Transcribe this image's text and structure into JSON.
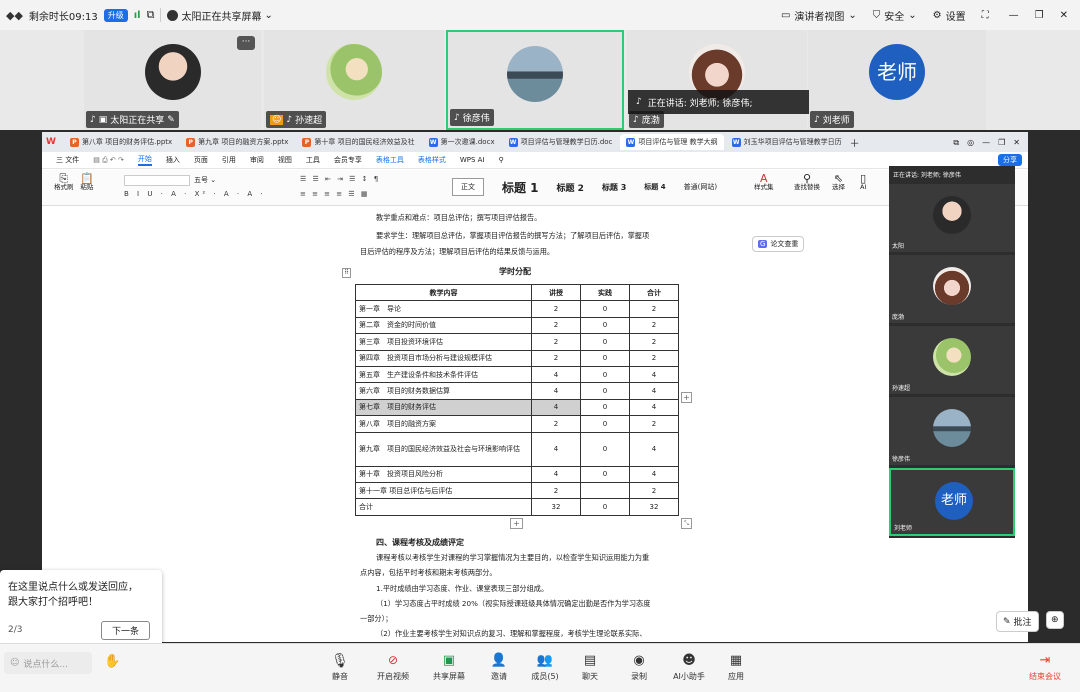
{
  "topbar": {
    "time_left": "剩余时长09:13",
    "upgrade": "升级",
    "sharing": "太阳正在共享屏幕",
    "presenter_view": "演讲者视图",
    "security": "安全",
    "settings": "设置"
  },
  "participants": [
    {
      "name": "太阳正在共享",
      "avatar_color": "#3a3a3a"
    },
    {
      "name": "孙速超",
      "avatar_color": "#7aa24a"
    },
    {
      "name": "徐彦伟",
      "avatar_color": "#6d8aa0"
    },
    {
      "name": "庞渤",
      "avatar_color": "#8a5a4a"
    },
    {
      "name": "刘老师",
      "avatar_text": "老师",
      "avatar_color": "#1f5fbf"
    }
  ],
  "speaking": "正在讲话:  刘老师; 徐彦伟;",
  "doc_tabs": [
    {
      "label": "第八章 项目的财务评估.pptx",
      "type": "P"
    },
    {
      "label": "第九章 项目的融资方案.pptx",
      "type": "P"
    },
    {
      "label": "第十章 项目的国民经济效益及社",
      "type": "P"
    },
    {
      "label": "第一次邀课.docx",
      "type": "W"
    },
    {
      "label": "项目评估与管理教学日历.doc",
      "type": "W"
    },
    {
      "label": "项目评估与管理 教学大纲",
      "type": "W"
    },
    {
      "label": "刘玉华项目评估与管理教学日历",
      "type": "W"
    }
  ],
  "menus": [
    "三 文件",
    "开始",
    "插入",
    "页面",
    "引用",
    "审阅",
    "视图",
    "工具",
    "会员专享",
    "表格工具",
    "表格样式",
    "WPS AI"
  ],
  "share_label": "分享",
  "styles": [
    "正文",
    "标题 1",
    "标题 2",
    "标题 3",
    "标题 4",
    "普通(网站)"
  ],
  "ribbon": {
    "format_painter": "格式刷",
    "paste": "粘贴",
    "font_size": "五号",
    "style_set": "样式集",
    "find_replace": "查找替换",
    "select": "选择",
    "ai": "AI"
  },
  "side_button": "论文查重",
  "doc": {
    "line1": "教学重点和难点：项目总评估；撰写项目评估报告。",
    "line2": "要求学生：理解项目总评估，掌握项目评估报告的撰写方法；了解项目后评估，掌握项",
    "line3": "目后评估的程序及方法；理解项目后评估的结果反馈与运用。",
    "table_title": "学时分配",
    "headers": [
      "教学内容",
      "讲授",
      "实践",
      "合计"
    ],
    "rows": [
      [
        "第一章　导论",
        "2",
        "0",
        "2"
      ],
      [
        "第二章　资金的时间价值",
        "2",
        "0",
        "2"
      ],
      [
        "第三章　项目投资环境评估",
        "2",
        "0",
        "2"
      ],
      [
        "第四章　投资项目市场分析与建设规模评估",
        "2",
        "0",
        "2"
      ],
      [
        "第五章　生产建设条件和技术条件评估",
        "4",
        "0",
        "4"
      ],
      [
        "第六章　项目的财务数据估算",
        "4",
        "0",
        "4"
      ],
      [
        "第七章　项目的财务评估",
        "4",
        "0",
        "4"
      ],
      [
        "第八章　项目的融资方案",
        "2",
        "0",
        "2"
      ],
      [
        "第九章　项目的国民经济效益及社会与环境影响评估",
        "4",
        "0",
        "4"
      ],
      [
        "第十章　投资项目风险分析",
        "4",
        "0",
        "4"
      ],
      [
        "第十一章 项目总评估与后评估",
        "2",
        "",
        "2"
      ],
      [
        "合计",
        "32",
        "0",
        "32"
      ]
    ],
    "section": "四、课程考核及成绩评定",
    "p1": "课程考核以考核学生对课程的学习掌握情况为主要目的，以检查学生知识运用能力为重",
    "p1b": "点内容，包括平时考核和期末考核两部分。",
    "p2": "1.平时成绩由学习态度、作业、课堂表现三部分组成。",
    "p3": "（1）学习态度占平时成绩 20%（视实际授课班级具体情况确定出勤是否作为学习态度",
    "p3b": "一部分）；",
    "p4": "（2）作业主要考核学生对知识点的复习、理解和掌握程度，考核学生理论联系实际、"
  },
  "video_column": {
    "speaking": "正在讲话:  刘老师; 徐彦伟",
    "tiles": [
      {
        "name": "太阳",
        "color": "#3c3c3c"
      },
      {
        "name": "庞渤",
        "color": "#8a5a4a"
      },
      {
        "name": "孙速超",
        "color": "#7aa24a"
      },
      {
        "name": "徐彦伟",
        "color": "#6d8aa0"
      },
      {
        "name": "刘老师",
        "avatar_text": "老师",
        "color": "#1f5fbf"
      }
    ]
  },
  "annotate": "批注",
  "popup": {
    "text1": "在这里说点什么或发送回应，",
    "text2": "跟大家打个招呼吧！",
    "page": "2/3",
    "next": "下一条"
  },
  "chat_placeholder": "说点什么...",
  "toolbar": [
    "静音",
    "开启视频",
    "共享屏幕",
    "邀请",
    "成员(5)",
    "聊天",
    "录制",
    "AI小助手",
    "应用"
  ],
  "end_meeting": "结束会议",
  "colors": {
    "accent": "#1a6fe8",
    "end": "#e8412c",
    "dark": "#2b2b2b"
  }
}
